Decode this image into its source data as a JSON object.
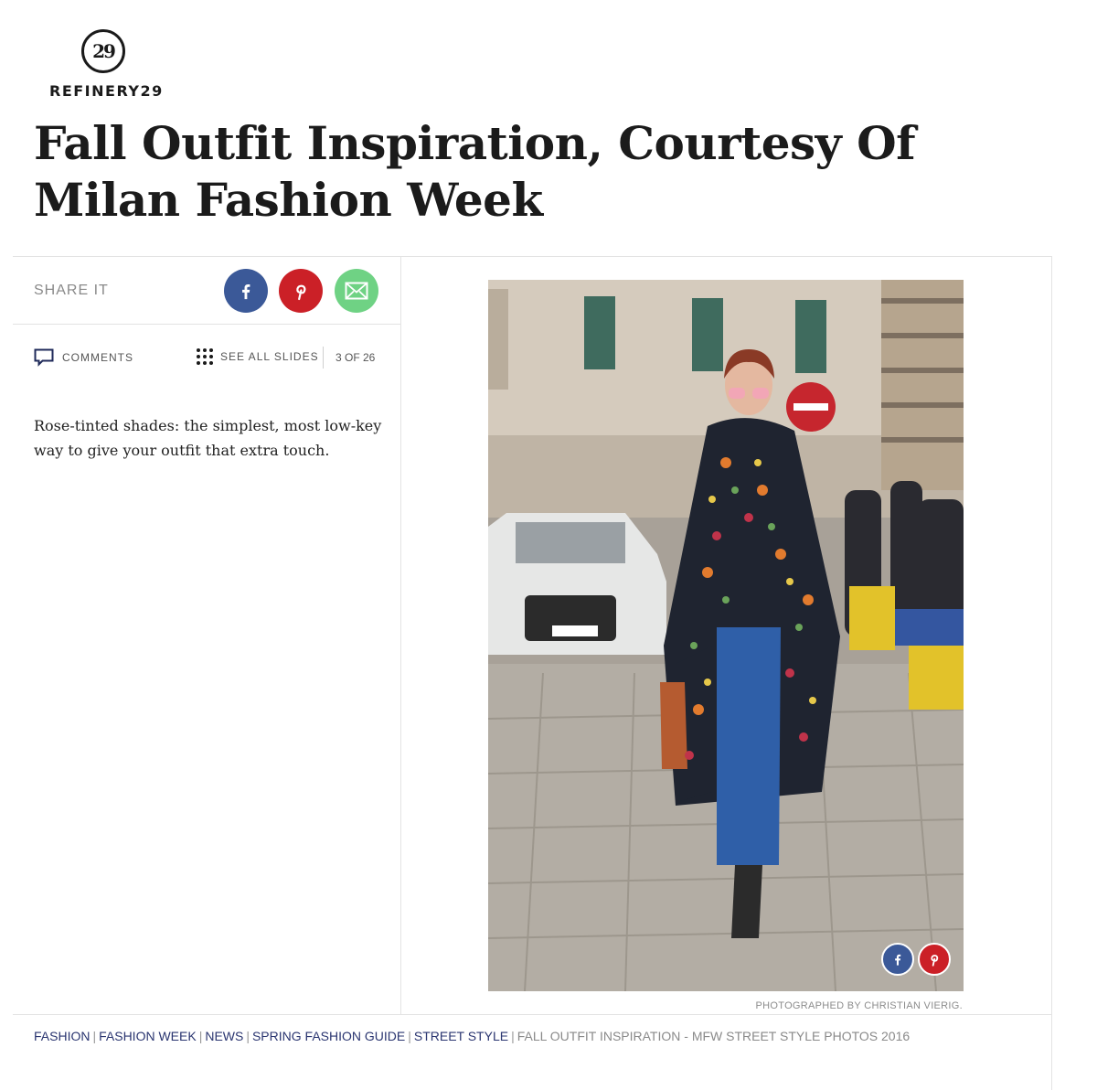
{
  "brand": {
    "logo_mark": "29",
    "name": "REFINERY29"
  },
  "article": {
    "title": "Fall Outfit Inspiration, Courtesy Of Milan Fashion Week"
  },
  "share": {
    "label": "SHARE IT",
    "buttons": [
      "facebook-icon",
      "pinterest-icon",
      "email-icon"
    ]
  },
  "toolbar": {
    "comments_label": "COMMENTS",
    "see_all_label": "SEE ALL SLIDES",
    "slide_counter": "3 OF 26"
  },
  "slide": {
    "caption": "Rose-tinted shades: the simplest, most low-key way to give your outfit that extra touch.",
    "photo_credit": "PHOTOGRAPHED BY CHRISTIAN VIERIG."
  },
  "tags": {
    "links": [
      "FASHION",
      "FASHION WEEK",
      "NEWS",
      "SPRING FASHION GUIDE",
      "STREET STYLE"
    ],
    "current": "FALL OUTFIT INSPIRATION - MFW STREET STYLE PHOTOS 2016"
  },
  "colors": {
    "facebook": "#3b5998",
    "pinterest": "#cb2027",
    "email": "#6fd284",
    "tag_link": "#2a3570"
  }
}
